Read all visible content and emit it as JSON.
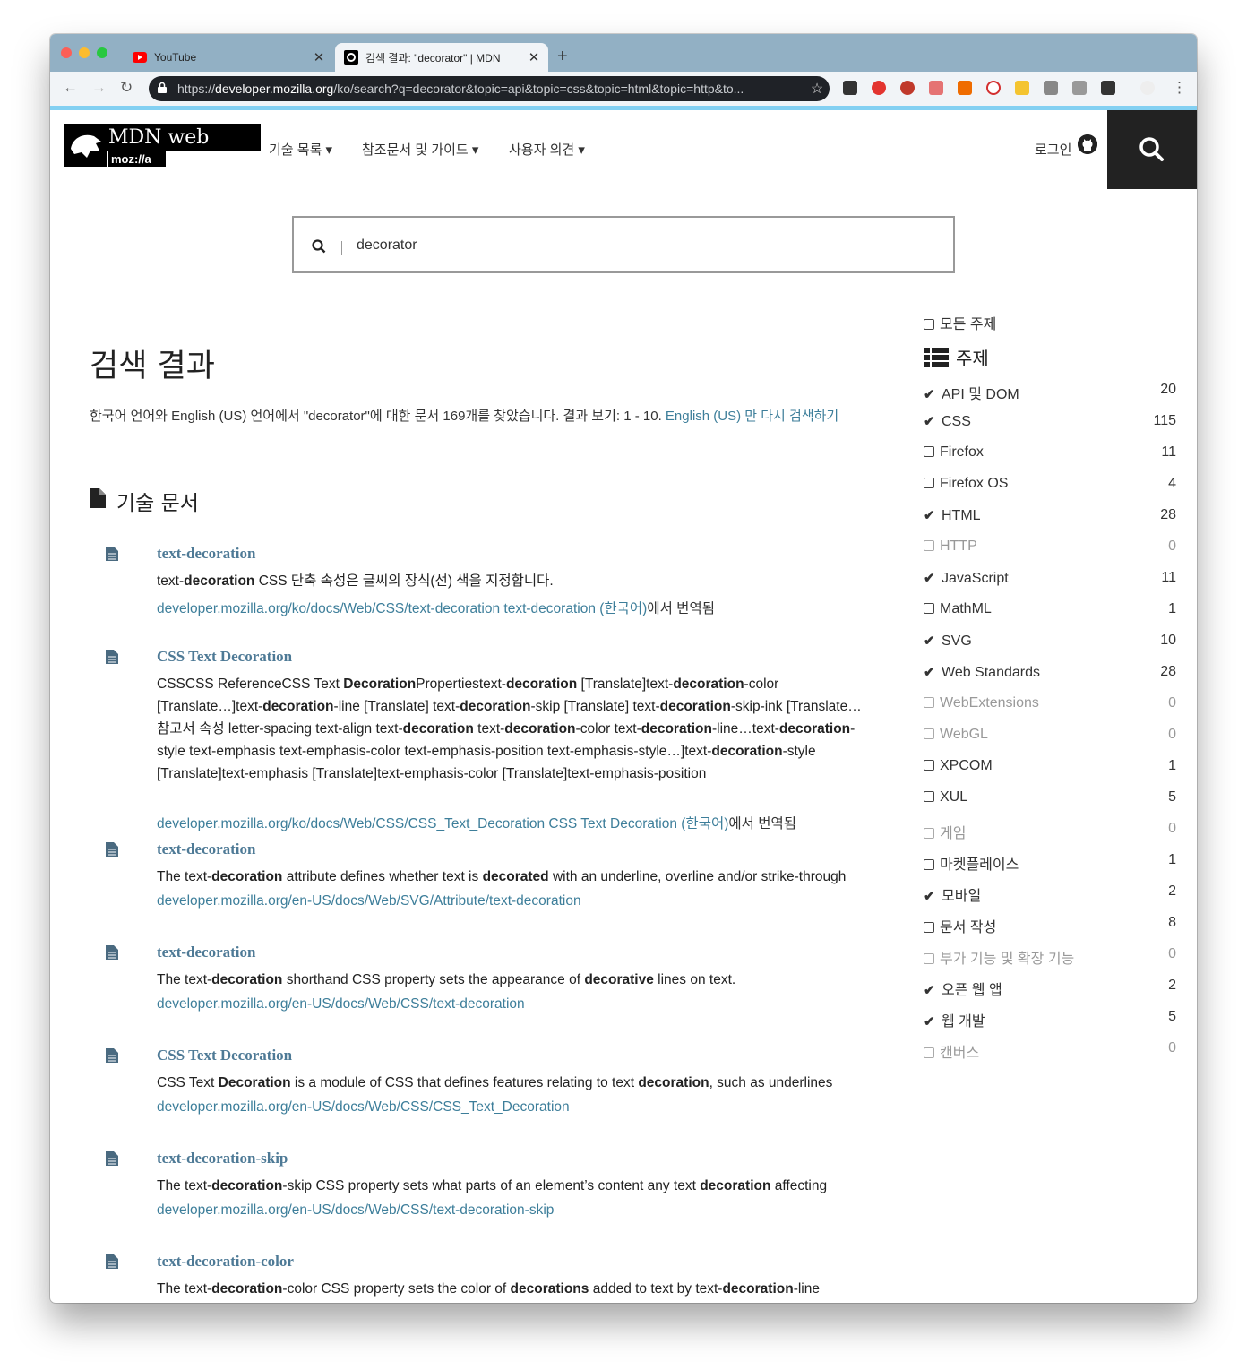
{
  "browser": {
    "tabs": [
      {
        "title": "YouTube",
        "active": false
      },
      {
        "title": "검색 결과: \"decorator\" | MDN",
        "active": true
      }
    ],
    "url_prefix": "https://",
    "url_host": "developer.mozilla.org",
    "url_path": "/ko/search?q=decorator&topic=api&topic=css&topic=html&topic=http&to..."
  },
  "header": {
    "logo_word": "MDN web docs",
    "logo_moz": "moz://a",
    "menu": [
      "기술 목록",
      "참조문서 및 가이드",
      "사용자 의견"
    ],
    "login": "로그인"
  },
  "search": {
    "value": "decorator"
  },
  "main": {
    "title": "검색 결과",
    "summary": "한국어 언어와 English (US) 언어에서 \"decorator\"에 대한 문서 169개를 찾았습니다. 결과 보기: 1 - 10. ",
    "summary_link": "English (US) 만 다시 검색하기",
    "section_title": "기술 문서"
  },
  "results": [
    {
      "title": "text-decoration",
      "excerpt_html": "text-<b>decoration</b> CSS 단축 속성은 글씨의 장식(선) 색을 지정합니다.",
      "url": "developer.mozilla.org/ko/docs/Web/CSS/text-decoration text-decoration (한국어)",
      "url_suffix": "에서 번역됨"
    },
    {
      "title": "CSS Text Decoration",
      "excerpt_html": "CSSCSS ReferenceCSS Text <b>Decoration</b>Propertiestext-<b>decoration</b> [Translate]text-<b>decoration</b>-color [Translate…]text-<b>decoration</b>-line [Translate] text-<b>decoration</b>-skip [Translate] text-<b>decoration</b>-skip-ink [Translate…참고서 속성 letter-spacing text-align text-<b>decoration</b> text-<b>decoration</b>-color text-<b>decoration</b>-line…text-<b>decoration</b>-style text-emphasis text-emphasis-color text-emphasis-position text-emphasis-style…]text-<b>decoration</b>-style [Translate]text-emphasis [Translate]text-emphasis-color [Translate]text-emphasis-position",
      "url": "developer.mozilla.org/ko/docs/Web/CSS/CSS_Text_Decoration CSS Text Decoration (한국어)",
      "url_suffix": "에서 번역됨"
    },
    {
      "title": "text-decoration",
      "excerpt_html": "The text-<b>decoration</b> attribute defines whether text is <b>decorated</b> with an underline, overline and/or strike-through",
      "url": "developer.mozilla.org/en-US/docs/Web/SVG/Attribute/text-decoration",
      "url_suffix": ""
    },
    {
      "title": "text-decoration",
      "excerpt_html": "The text-<b>decoration</b> shorthand CSS property sets the appearance of <b>decorative</b> lines on text.",
      "url": "developer.mozilla.org/en-US/docs/Web/CSS/text-decoration",
      "url_suffix": ""
    },
    {
      "title": "CSS Text Decoration",
      "excerpt_html": "CSS Text <b>Decoration</b> is a module of CSS that defines features relating to text <b>decoration</b>, such as underlines",
      "url": "developer.mozilla.org/en-US/docs/Web/CSS/CSS_Text_Decoration",
      "url_suffix": ""
    },
    {
      "title": "text-decoration-skip",
      "excerpt_html": "The text-<b>decoration</b>-skip CSS property sets what parts of an element’s content any text <b>decoration</b> affecting",
      "url": "developer.mozilla.org/en-US/docs/Web/CSS/text-decoration-skip",
      "url_suffix": ""
    },
    {
      "title": "text-decoration-color",
      "excerpt_html": "The text-<b>decoration</b>-color CSS property sets the color of <b>decorations</b> added to text by text-<b>decoration</b>-line",
      "url": "",
      "url_suffix": ""
    }
  ],
  "sidebar": {
    "all_topics": "모든 주제",
    "topics_heading": "주제",
    "topics": [
      {
        "label": "API 및 DOM",
        "count": "20",
        "checked": true,
        "disabled": false
      },
      {
        "label": "CSS",
        "count": "115",
        "checked": true,
        "disabled": false
      },
      {
        "label": "Firefox",
        "count": "11",
        "checked": false,
        "disabled": false
      },
      {
        "label": "Firefox OS",
        "count": "4",
        "checked": false,
        "disabled": false
      },
      {
        "label": "HTML",
        "count": "28",
        "checked": true,
        "disabled": false
      },
      {
        "label": "HTTP",
        "count": "0",
        "checked": false,
        "disabled": true
      },
      {
        "label": "JavaScript",
        "count": "11",
        "checked": true,
        "disabled": false
      },
      {
        "label": "MathML",
        "count": "1",
        "checked": false,
        "disabled": false
      },
      {
        "label": "SVG",
        "count": "10",
        "checked": true,
        "disabled": false
      },
      {
        "label": "Web Standards",
        "count": "28",
        "checked": true,
        "disabled": false
      },
      {
        "label": "WebExtensions",
        "count": "0",
        "checked": false,
        "disabled": true
      },
      {
        "label": "WebGL",
        "count": "0",
        "checked": false,
        "disabled": true
      },
      {
        "label": "XPCOM",
        "count": "1",
        "checked": false,
        "disabled": false
      },
      {
        "label": "XUL",
        "count": "5",
        "checked": false,
        "disabled": false
      },
      {
        "label": "게임",
        "count": "0",
        "checked": false,
        "disabled": true
      },
      {
        "label": "마켓플레이스",
        "count": "1",
        "checked": false,
        "disabled": false
      },
      {
        "label": "모바일",
        "count": "2",
        "checked": true,
        "disabled": false
      },
      {
        "label": "문서 작성",
        "count": "8",
        "checked": false,
        "disabled": false
      },
      {
        "label": "부가 기능 및 확장 기능",
        "count": "0",
        "checked": false,
        "disabled": true
      },
      {
        "label": "오픈 웹 앱",
        "count": "2",
        "checked": true,
        "disabled": false
      },
      {
        "label": "웹 개발",
        "count": "5",
        "checked": true,
        "disabled": false
      },
      {
        "label": "캔버스",
        "count": "0",
        "checked": false,
        "disabled": true
      }
    ]
  },
  "colors": {
    "link": "#3d7e9a",
    "title_link": "#4e7a96",
    "accent_bar": "#83d0f2",
    "tabstrip": "#92b0c4"
  }
}
